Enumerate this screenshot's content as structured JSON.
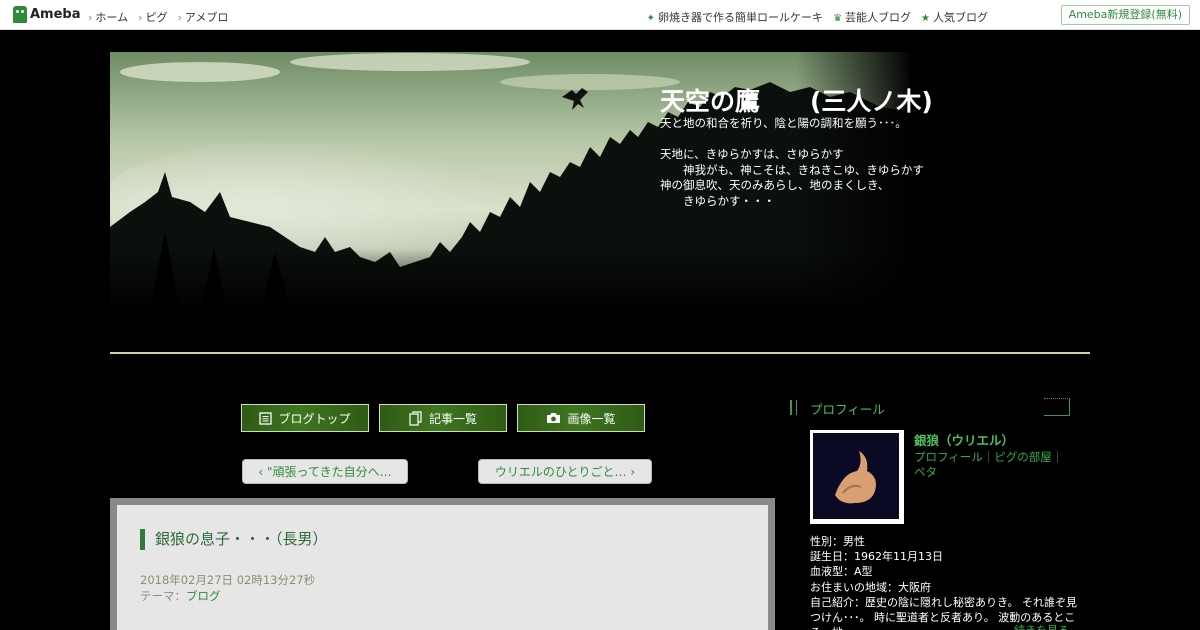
{
  "topbar": {
    "logo": "Ameba",
    "nav": [
      "ホーム",
      "ピグ",
      "アメブロ"
    ],
    "links": [
      {
        "icon": "sparkle-icon",
        "label": "卵焼き器で作る簡単ロールケーキ"
      },
      {
        "icon": "crown-icon",
        "label": "芸能人ブログ"
      },
      {
        "icon": "star-icon",
        "label": "人気ブログ"
      }
    ],
    "signup": "Ameba新規登録(無料)"
  },
  "header": {
    "title": "天空の鷹　　(三人ノ木)",
    "description": "天と地の和合を祈り、陰と陽の調和を願う･･･。\n\n天地に、きゆらかすは、さゆらかす\n　　神我がも、神こそは、きねきこゆ、きゆらかす\n神の御息吹、天のみあらし、地のまくしき、\n　　きゆらかす・・・"
  },
  "nav_buttons": [
    {
      "icon": "document-icon",
      "label": "ブログトップ"
    },
    {
      "icon": "copy-icon",
      "label": "記事一覧"
    },
    {
      "icon": "camera-icon",
      "label": "画像一覧"
    }
  ],
  "pager": {
    "prev": "‹ \"頑張ってきた自分へ…",
    "next": "ウリエルのひとりごと… ›"
  },
  "entry": {
    "title": "銀狼の息子・・・（長男）",
    "date": "2018年02月27日 02時13分27秒",
    "theme_label": "テーマ：",
    "theme": "ブログ"
  },
  "sidebar": {
    "heading": "プロフィール",
    "name": "銀狼（ウリエル）",
    "links": "プロフィール｜ピグの部屋｜ペタ",
    "info": [
      "性別：男性",
      "誕生日：1962年11月13日",
      "血液型：A型",
      "お住まいの地域：大阪府",
      "自己紹介：歴史の陰に隠れし秘密ありき。 それ誰ぞ見つけん･･･。 時に聖道者と反者あり。 波動のあるところ、地..."
    ],
    "more": "続きを見る"
  },
  "colors": {
    "accent": "#2d8c3c",
    "header_line": "#c9d6a0",
    "article_bg": "#e6e6e6"
  }
}
